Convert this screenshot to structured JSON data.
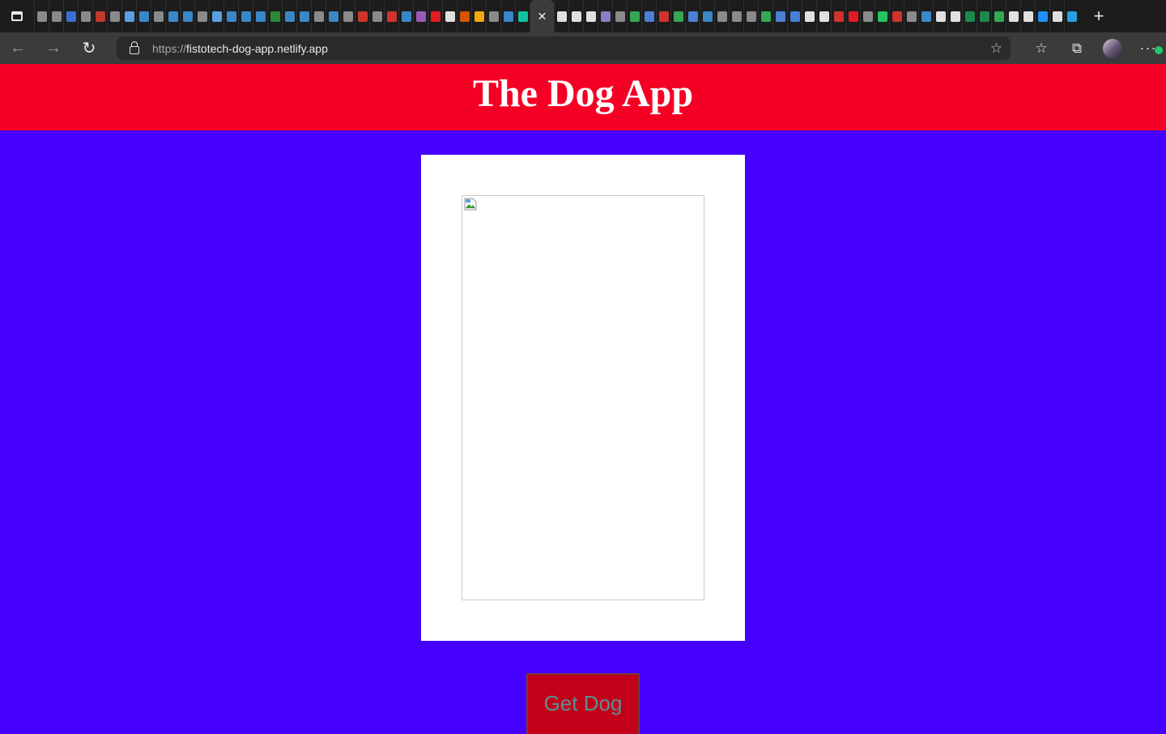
{
  "browser": {
    "url_scheme": "https://",
    "url_host": "fistotech-dog-app.netlify.app",
    "active_tab_close": "✕",
    "new_tab": "+",
    "tab_colors": [
      "#8a8a8a",
      "#8a8a8a",
      "#3b6fd6",
      "#8a8a8a",
      "#c0392b",
      "#8a8a8a",
      "#5aa0e0",
      "#3a87c8",
      "#8a8a8a",
      "#3a87c8",
      "#3a87c8",
      "#8a8a8a",
      "#5aa0e0",
      "#3a87c8",
      "#3a87c8",
      "#3a87c8",
      "#2a8a3a",
      "#3a87c8",
      "#3a87c8",
      "#8a8a8a",
      "#3a87c8",
      "#8a8a8a",
      "#d0342c",
      "#8a8a8a",
      "#d0342c",
      "#3a87c8",
      "#9b59b6",
      "#e31b23",
      "#e0e0e0",
      "#d35400",
      "#f1a90d",
      "#8a8a8a",
      "#3a87c8",
      "#12c3a0"
    ],
    "tab_colors_right": [
      "#e0e0e0",
      "#e0e0e0",
      "#e0e0e0",
      "#8e7cc3",
      "#8a8a8a",
      "#34a853",
      "#4a7fd6",
      "#d0342c",
      "#34a853",
      "#4a7fd6",
      "#3a87c8",
      "#8a8a8a",
      "#8a8a8a",
      "#8a8a8a",
      "#34a853",
      "#4a7fd6",
      "#4a7fd6",
      "#e0e0e0",
      "#e0e0e0",
      "#d0342c",
      "#e31b23",
      "#8a8a8a",
      "#22c55e",
      "#d0342c",
      "#8a8a8a",
      "#3a87c8",
      "#e0e0e0",
      "#e0e0e0",
      "#1b8a4a",
      "#1b8a4a",
      "#34a853",
      "#e0e0e0",
      "#e0e0e0",
      "#1e90ff",
      "#e0e0e0",
      "#2aa0e0"
    ]
  },
  "app": {
    "title": "The Dog App",
    "button_label": "Get Dog",
    "colors": {
      "background": "#4600ff",
      "header": "#f50025",
      "button": "#c3001a",
      "button_text": "#5b9090"
    }
  }
}
